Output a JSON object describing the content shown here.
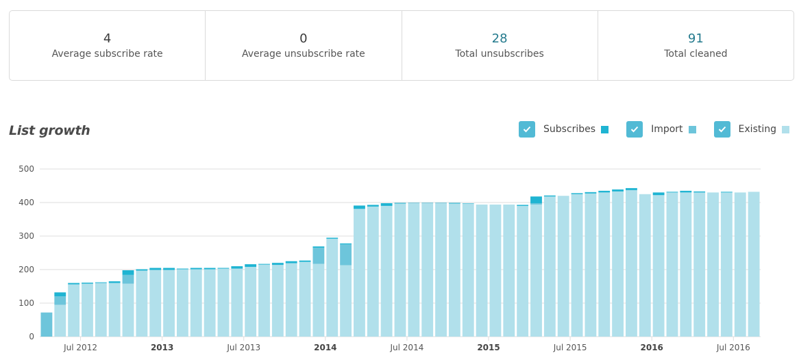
{
  "stats": [
    {
      "value": "4",
      "label": "Average subscribe rate",
      "accent": false
    },
    {
      "value": "0",
      "label": "Average unsubscribe rate",
      "accent": false
    },
    {
      "value": "28",
      "label": "Total unsubscribes",
      "accent": true
    },
    {
      "value": "91",
      "label": "Total cleaned",
      "accent": true
    }
  ],
  "colors": {
    "subscribes": "#1fb4d2",
    "import": "#6dc5db",
    "existing": "#b1e0eb",
    "checkbox": "#52bad5",
    "grid": "#dddddd",
    "axis_text": "#555555"
  },
  "chart_data": {
    "type": "bar",
    "stacked": true,
    "title": "List growth",
    "xlabel": "",
    "ylabel": "",
    "ylim": [
      0,
      500
    ],
    "yticks": [
      0,
      100,
      200,
      300,
      400,
      500
    ],
    "grid": true,
    "legend": "top-right",
    "legend_entries": [
      {
        "name": "Subscribes",
        "checked": true
      },
      {
        "name": "Import",
        "checked": true
      },
      {
        "name": "Existing",
        "checked": true
      }
    ],
    "x_start": "Apr 2012",
    "x_ticks": [
      {
        "label": "Jul 2012",
        "index": 3,
        "bold": false
      },
      {
        "label": "2013",
        "index": 9,
        "bold": true
      },
      {
        "label": "Jul 2013",
        "index": 15,
        "bold": false
      },
      {
        "label": "2014",
        "index": 21,
        "bold": true
      },
      {
        "label": "Jul 2014",
        "index": 27,
        "bold": false
      },
      {
        "label": "2015",
        "index": 33,
        "bold": true
      },
      {
        "label": "Jul 2015",
        "index": 39,
        "bold": false
      },
      {
        "label": "2016",
        "index": 45,
        "bold": true
      },
      {
        "label": "Jul 2016",
        "index": 51,
        "bold": false
      }
    ],
    "series": [
      {
        "name": "Existing",
        "values": [
          0,
          95,
          156,
          158,
          160,
          160,
          158,
          197,
          199,
          199,
          201,
          201,
          201,
          203,
          203,
          208,
          215,
          214,
          219,
          223,
          217,
          292,
          213,
          381,
          388,
          390,
          397,
          398,
          398,
          398,
          397,
          397,
          394,
          394,
          394,
          390,
          394,
          418,
          420,
          425,
          427,
          430,
          433,
          437,
          425,
          422,
          430,
          430,
          430,
          430,
          430,
          430,
          432
        ]
      },
      {
        "name": "Import",
        "values": [
          72,
          25,
          0,
          0,
          0,
          0,
          26,
          0,
          0,
          0,
          0,
          0,
          0,
          0,
          0,
          0,
          0,
          0,
          0,
          0,
          48,
          0,
          62,
          0,
          0,
          0,
          0,
          0,
          0,
          0,
          0,
          0,
          0,
          0,
          0,
          0,
          4,
          0,
          0,
          0,
          0,
          0,
          0,
          0,
          0,
          0,
          0,
          0,
          0,
          0,
          0,
          0,
          0
        ]
      },
      {
        "name": "Subscribes",
        "values": [
          0,
          12,
          4,
          3,
          2,
          5,
          14,
          4,
          6,
          6,
          2,
          4,
          4,
          2,
          7,
          8,
          2,
          6,
          6,
          4,
          4,
          3,
          3,
          10,
          5,
          8,
          2,
          1,
          1,
          1,
          2,
          1,
          0,
          0,
          0,
          3,
          20,
          3,
          0,
          3,
          4,
          5,
          6,
          6,
          0,
          8,
          2,
          5,
          3,
          0,
          2,
          0,
          0
        ]
      }
    ]
  }
}
